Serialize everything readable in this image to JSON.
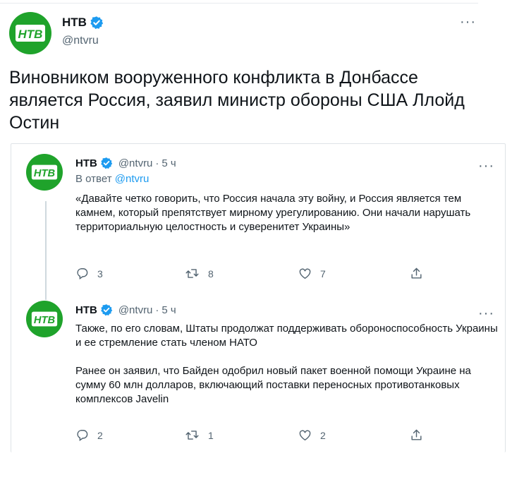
{
  "colors": {
    "brand_green": "#1fa32b",
    "verified_blue": "#1d9bf0",
    "secondary_text": "#536471",
    "link": "#1d9bf0"
  },
  "main_tweet": {
    "name": "НТВ",
    "handle": "@ntvru",
    "verified_icon": "verified-badge-icon",
    "more_label": "···",
    "text": "Виновником вооруженного конфликта в Донбассе является Россия, заявил министр обороны США Ллойд Остин"
  },
  "thread": [
    {
      "name": "НТВ",
      "handle": "@ntvru",
      "separator": "·",
      "time": "5 ч",
      "more_label": "···",
      "reply_prefix": "В ответ",
      "reply_to": "@ntvru",
      "text": "«Давайте четко говорить, что Россия начала эту войну, и Россия является тем камнем, который препятствует мирному урегулированию. Они начали нарушать территориальную целостность и суверенитет Украины»",
      "replies": "3",
      "retweets": "8",
      "likes": "7"
    },
    {
      "name": "НТВ",
      "handle": "@ntvru",
      "separator": "·",
      "time": "5 ч",
      "more_label": "···",
      "text_p1": "Также, по его словам, Штаты продолжат поддерживать обороноспособность Украины и ее стремление стать членом НАТО",
      "text_p2": "Ранее он заявил, что Байден одобрил новый пакет военной помощи Украине на сумму 60 млн долларов, включающий поставки переносных противотанковых комплексов Javelin",
      "replies": "2",
      "retweets": "1",
      "likes": "2"
    }
  ],
  "logo_text": "НТВ"
}
